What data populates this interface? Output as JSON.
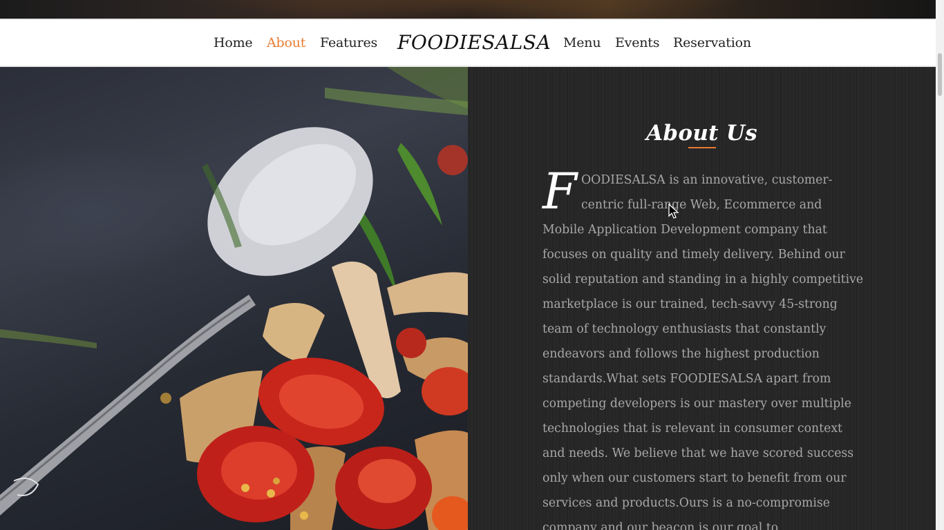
{
  "nav": {
    "left_links": [
      "Home",
      "About",
      "Features"
    ],
    "brand": "FOODIESALSA",
    "right_links": [
      "Menu",
      "Events",
      "Reservation"
    ],
    "active": "About"
  },
  "about": {
    "title": "About Us",
    "drop_cap": "F",
    "body": "OODIESALSA is an innovative, customer-centric full-range Web, Ecommerce and Mobile Application Development company that focuses on quality and timely delivery. Behind our solid reputation and standing in a highly competitive marketplace is our trained, tech-savvy 45-strong team of technology enthusiasts that constantly endeavors and follows the highest production standards.What sets FOODIESALSA apart from competing developers is our mastery over multiple technologies that is relevant in consumer context and needs. We believe that we have scored success only when our customers start to benefit from our services and products.Ours is a no-compromise company and our beacon is our goal to"
  },
  "colors": {
    "accent": "#e87c33",
    "panel_bg": "#262626",
    "body_text": "#a8a8a8"
  },
  "icons": {
    "cursor": "mouse-pointer-icon"
  }
}
